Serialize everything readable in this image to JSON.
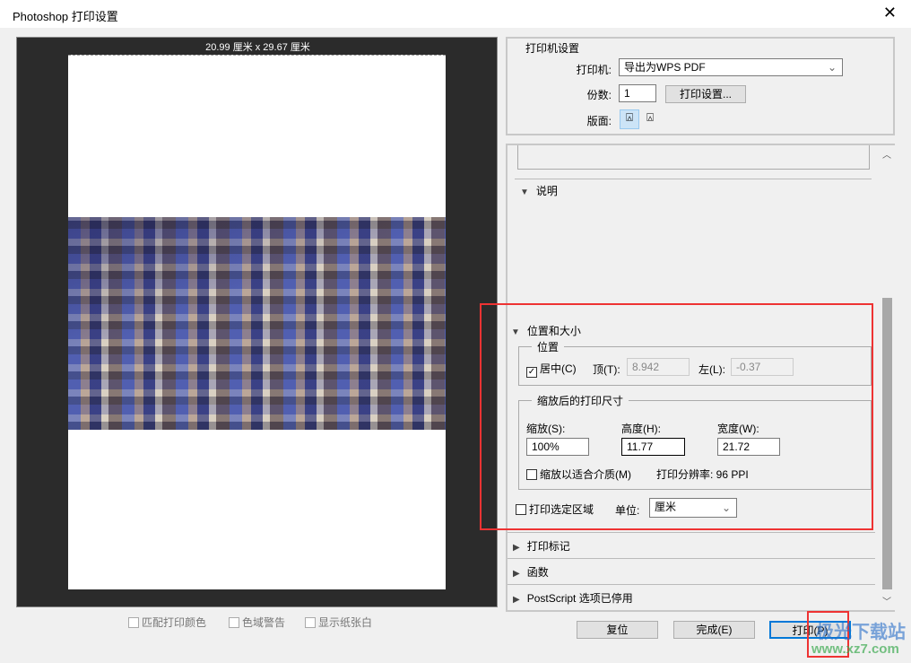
{
  "window": {
    "title": "Photoshop 打印设置",
    "close_label": "✕"
  },
  "preview": {
    "dimensions": "20.99 厘米 x 29.67 厘米",
    "options": [
      {
        "label": "匹配打印颜色",
        "checked": false
      },
      {
        "label": "色域警告",
        "checked": false
      },
      {
        "label": "显示纸张白",
        "checked": false
      }
    ]
  },
  "printer_settings": {
    "heading": "打印机设置",
    "printer_label": "打印机:",
    "printer_value": "导出为WPS PDF",
    "copies_label": "份数:",
    "copies_value": "1",
    "print_settings_button": "打印设置...",
    "layout_label": "版面:"
  },
  "sections": {
    "description": "说明",
    "position_size": "位置和大小",
    "print_marks": "打印标记",
    "functions": "函数",
    "postscript": "PostScript 选项已停用"
  },
  "position": {
    "legend": "位置",
    "center_label": "居中(C)",
    "center_checked": true,
    "top_label": "顶(T):",
    "top_value": "8.942",
    "left_label": "左(L):",
    "left_value": "-0.37"
  },
  "scaled": {
    "legend": "缩放后的打印尺寸",
    "scale_label": "缩放(S):",
    "scale_value": "100%",
    "height_label": "高度(H):",
    "height_value": "11.77",
    "width_label": "宽度(W):",
    "width_value": "21.72",
    "fit_media_label": "缩放以适合介质(M)",
    "fit_media_checked": false,
    "resolution": "打印分辨率: 96 PPI"
  },
  "print_selected_label": "打印选定区域",
  "unit_label": "单位:",
  "unit_value": "厘米",
  "buttons": {
    "reset": "复位",
    "done": "完成(E)",
    "print": "打印(P)"
  },
  "watermark": {
    "text": "极光下载站",
    "url": "www.xz7.com"
  },
  "colors": {
    "highlight": "#e33333",
    "accent": "#0078d7"
  }
}
